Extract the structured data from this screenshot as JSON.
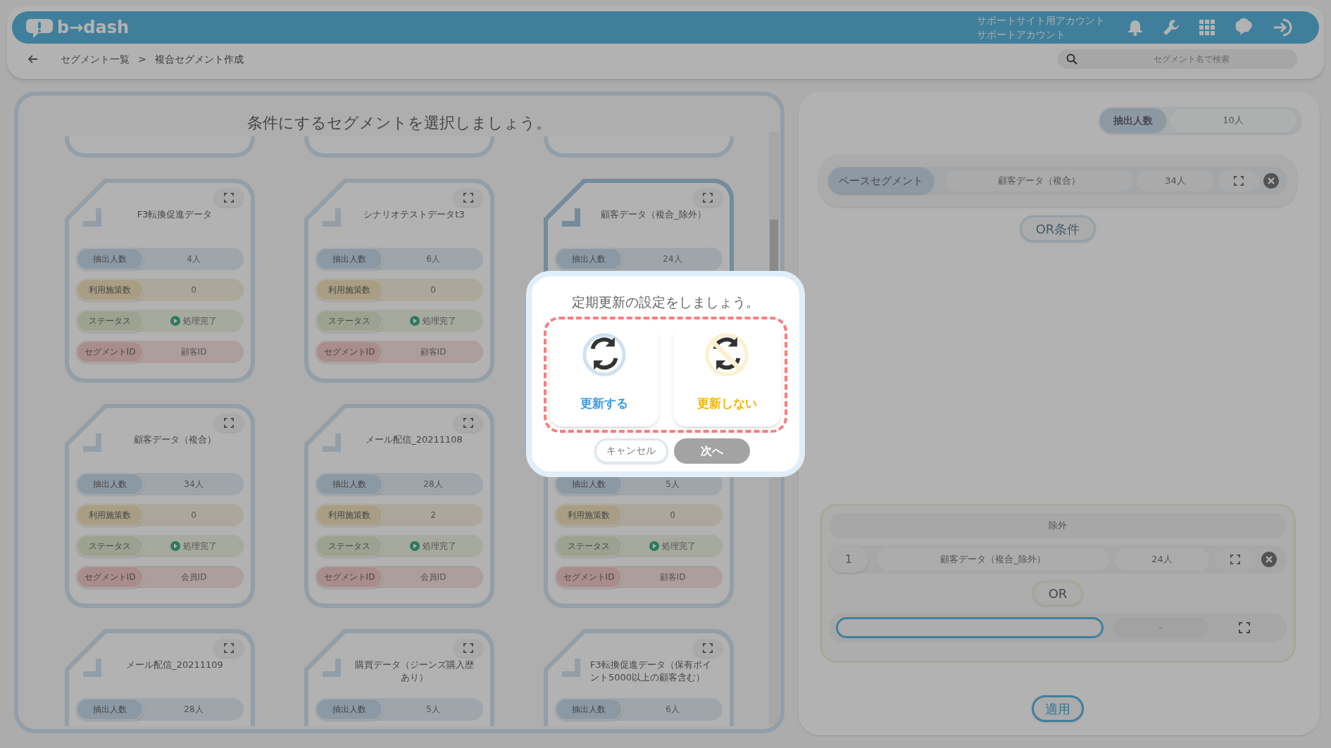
{
  "header": {
    "logo": "b→dash",
    "account_lines": [
      "サポートサイト用アカウント",
      "サポートアカウント"
    ]
  },
  "breadcrumb": {
    "items": [
      "セグメント一覧",
      "複合セグメント作成"
    ],
    "separator": ">"
  },
  "search": {
    "placeholder": "セグメント名で検索"
  },
  "left_panel": {
    "title": "条件にするセグメントを選択しましょう。",
    "cards": [
      {
        "name": "F3転換促進データ",
        "selected": false,
        "stats": [
          {
            "kind": "count",
            "label": "抽出人数",
            "value": "4人"
          },
          {
            "kind": "usage",
            "label": "利用施策数",
            "value": "0"
          },
          {
            "kind": "status",
            "label": "ステータス",
            "value": "処理完了"
          },
          {
            "kind": "id",
            "label": "セグメントID",
            "value": "顧客ID"
          }
        ]
      },
      {
        "name": "シナリオテストデータt3",
        "selected": false,
        "stats": [
          {
            "kind": "count",
            "label": "抽出人数",
            "value": "6人"
          },
          {
            "kind": "usage",
            "label": "利用施策数",
            "value": "0"
          },
          {
            "kind": "status",
            "label": "ステータス",
            "value": "処理完了"
          },
          {
            "kind": "id",
            "label": "セグメントID",
            "value": "顧客ID"
          }
        ]
      },
      {
        "name": "顧客データ（複合_除外）",
        "selected": true,
        "stats": [
          {
            "kind": "count",
            "label": "抽出人数",
            "value": "24人"
          }
        ]
      },
      {
        "name": "顧客データ（複合）",
        "selected": false,
        "stats": [
          {
            "kind": "count",
            "label": "抽出人数",
            "value": "34人"
          },
          {
            "kind": "usage",
            "label": "利用施策数",
            "value": "0"
          },
          {
            "kind": "status",
            "label": "ステータス",
            "value": "処理完了"
          },
          {
            "kind": "id",
            "label": "セグメントID",
            "value": "会員ID"
          }
        ]
      },
      {
        "name": "メール配信_20211108",
        "selected": false,
        "stats": [
          {
            "kind": "count",
            "label": "抽出人数",
            "value": "28人"
          },
          {
            "kind": "usage",
            "label": "利用施策数",
            "value": "2"
          },
          {
            "kind": "status",
            "label": "ステータス",
            "value": "処理完了"
          },
          {
            "kind": "id",
            "label": "セグメントID",
            "value": "会員ID"
          }
        ]
      },
      {
        "selected": false,
        "stats": [
          {
            "kind": "count",
            "label": "抽出人数",
            "value": "5人"
          },
          {
            "kind": "usage",
            "label": "利用施策数",
            "value": "0"
          },
          {
            "kind": "status",
            "label": "ステータス",
            "value": "処理完了"
          },
          {
            "kind": "id",
            "label": "セグメントID",
            "value": "顧客ID"
          }
        ]
      },
      {
        "name": "メール配信_20211109",
        "selected": false,
        "stats": [
          {
            "kind": "count",
            "label": "抽出人数",
            "value": "28人"
          }
        ]
      },
      {
        "name": "購買データ（ジーンズ購入歴あり）",
        "selected": false,
        "stats": [
          {
            "kind": "count",
            "label": "抽出人数",
            "value": "5人"
          }
        ]
      },
      {
        "name": "F3転換促進データ（保有ポイント5000以上の顧客含む）",
        "selected": false,
        "stats": [
          {
            "kind": "count",
            "label": "抽出人数",
            "value": "6人"
          }
        ]
      }
    ]
  },
  "right_panel": {
    "total": {
      "label": "抽出人数",
      "value": "10人"
    },
    "base": {
      "label": "ベースセグメント",
      "name": "顧客データ（複合）",
      "count": "34人"
    },
    "or_condition_button": "OR条件",
    "exclusion": {
      "title": "除外",
      "rows": [
        {
          "index": "1",
          "name": "顧客データ（複合_除外）",
          "count": "24人"
        }
      ],
      "or_button": "OR",
      "empty_row": {
        "count": "-"
      }
    },
    "apply_button": "適用"
  },
  "modal": {
    "title": "定期更新の設定をしましょう。",
    "options": [
      {
        "kind": "update",
        "label": "更新する"
      },
      {
        "kind": "no_update",
        "label": "更新しない"
      }
    ],
    "cancel": "キャンセル",
    "next": {
      "label": "次へ",
      "disabled": true
    }
  }
}
